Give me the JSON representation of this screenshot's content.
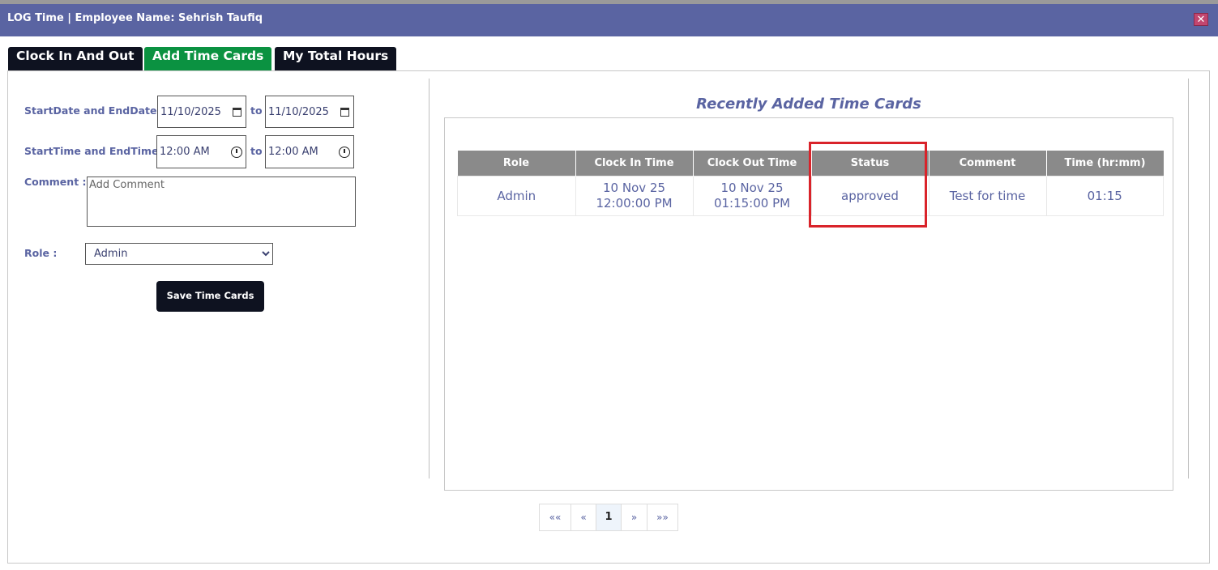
{
  "window": {
    "title": "LOG Time | Employee Name: Sehrish Taufiq",
    "close_glyph": "✕"
  },
  "tabs": [
    {
      "label": "Clock In And Out",
      "active": false
    },
    {
      "label": "Add Time Cards",
      "active": true
    },
    {
      "label": "My Total Hours",
      "active": false
    }
  ],
  "form": {
    "date_label": "StartDate and EndDate :",
    "start_date": "11/10/2025",
    "end_date": "11/10/2025",
    "to_label": "to",
    "time_label": "StartTime and EndTime :",
    "start_time": "12:00 AM",
    "end_time": "12:00 AM",
    "comment_label": "Comment :",
    "comment_placeholder": "Add Comment",
    "role_label": "Role :",
    "role_selected": "Admin",
    "save_label": "Save Time Cards"
  },
  "panel": {
    "title": "Recently Added Time Cards",
    "columns": [
      "Role",
      "Clock In Time",
      "Clock Out Time",
      "Status",
      "Comment",
      "Time (hr:mm)"
    ],
    "rows": [
      {
        "role": "Admin",
        "clock_in_date": "10 Nov 25",
        "clock_in_time": "12:00:00 PM",
        "clock_out_date": "10 Nov 25",
        "clock_out_time": "01:15:00 PM",
        "status": "approved",
        "comment": "Test for time",
        "time": "01:15"
      }
    ]
  },
  "pagination": {
    "first": "««",
    "prev": "«",
    "current": "1",
    "next": "»",
    "last": "»»"
  },
  "colors": {
    "header": "#5a64a2",
    "dark_tab": "#0e1220",
    "active_tab": "#0b9241",
    "highlight": "#d9232a"
  }
}
